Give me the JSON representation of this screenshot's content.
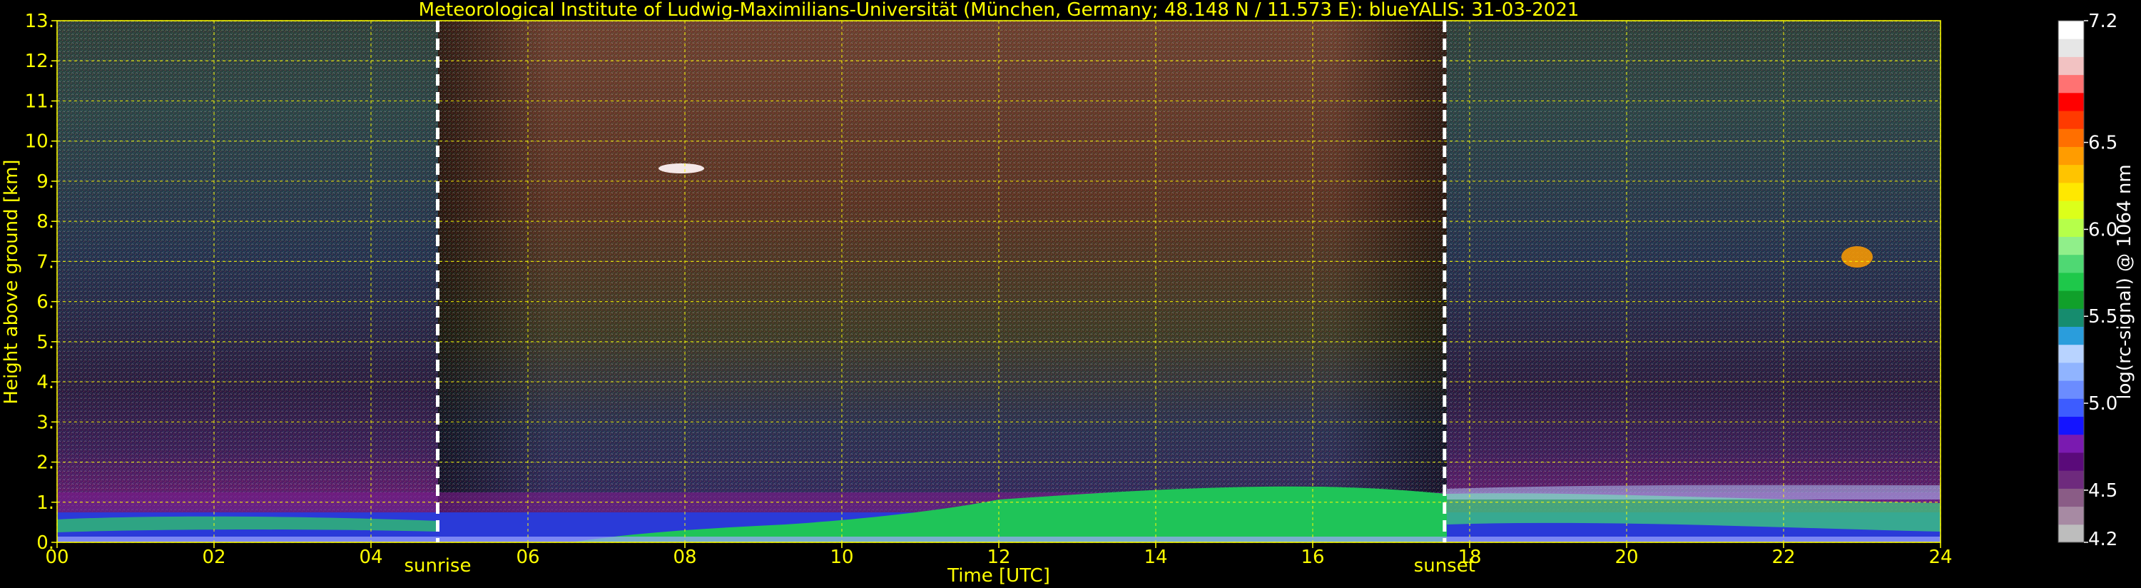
{
  "chart_data": {
    "type": "heatmap",
    "title": "Meteorological Institute of Ludwig-Maximilians-Universität (München, Germany; 48.148 N / 11.573 E):     blueYALIS: 31-03-2021",
    "xlabel": "Time [UTC]",
    "ylabel": "Height above ground [km]",
    "xlim": [
      0,
      24
    ],
    "ylim": [
      0,
      13
    ],
    "xticks": [
      0,
      2,
      4,
      6,
      8,
      10,
      12,
      14,
      16,
      18,
      20,
      22,
      24
    ],
    "xtick_labels": [
      "00",
      "02",
      "04",
      "06",
      "08",
      "10",
      "12",
      "14",
      "16",
      "18",
      "20",
      "22",
      "24"
    ],
    "yticks": [
      0,
      1,
      2,
      3,
      4,
      5,
      6,
      7,
      8,
      9,
      10,
      11,
      12,
      13
    ],
    "ytick_labels": [
      "0.",
      "1.",
      "2.",
      "3.",
      "4.",
      "5.",
      "6.",
      "7.",
      "8.",
      "9.",
      "10.",
      "11.",
      "12.",
      "13."
    ],
    "grid": true,
    "markers": [
      {
        "label": "sunrise",
        "x": 4.85
      },
      {
        "label": "sunset",
        "x": 17.68
      }
    ],
    "colorbar": {
      "label": "log(rc-signal) @ 1064 nm",
      "range": [
        4.2,
        7.2
      ],
      "ticks": [
        4.2,
        4.5,
        5.0,
        5.5,
        6.0,
        6.5,
        7.2
      ],
      "tick_labels": [
        "4.2",
        "4.5",
        "5.0",
        "5.5",
        "6.0",
        "6.5",
        "7.2"
      ],
      "colors": [
        "#bdbdbd",
        "#a78aa3",
        "#8a5c86",
        "#6e2a7d",
        "#5a0a7a",
        "#7a1ab0",
        "#1414ff",
        "#3d5cff",
        "#6b8cff",
        "#90b4ff",
        "#b8d3ff",
        "#2a9ddc",
        "#168c6e",
        "#10a02a",
        "#1ec84a",
        "#4fd873",
        "#90ef8a",
        "#b6ff4a",
        "#dcff1a",
        "#ffe800",
        "#ffc400",
        "#ff9c00",
        "#ff6f00",
        "#ff3a00",
        "#ff0000",
        "#ff7272",
        "#f2c2c2",
        "#e6e6e6",
        "#ffffff"
      ]
    },
    "features": [
      {
        "label": "",
        "kind": "cirrus",
        "x": [
          7.8,
          8.2
        ],
        "y": [
          9.1,
          9.35
        ]
      },
      {
        "label": "",
        "kind": "cirrus",
        "x": [
          22.5,
          23.05
        ],
        "y": [
          6.9,
          7.3
        ]
      }
    ]
  }
}
